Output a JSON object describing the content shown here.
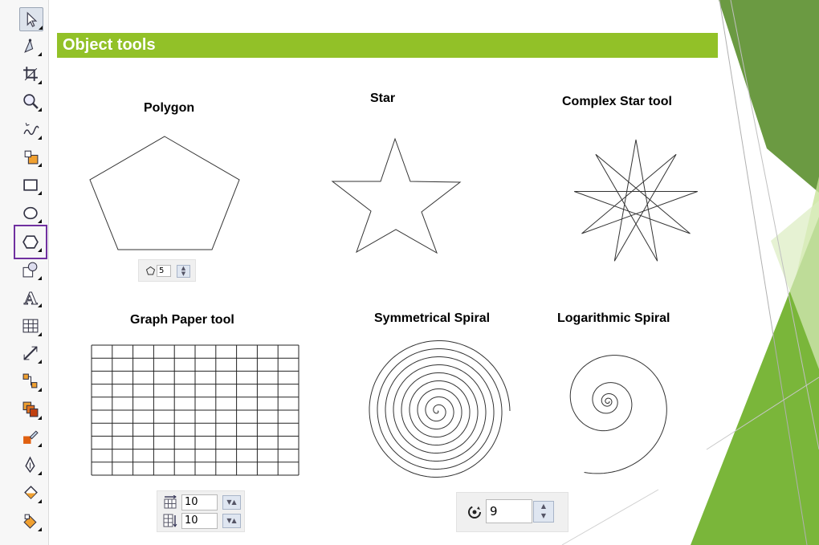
{
  "section": {
    "title": "Object tools"
  },
  "colors": {
    "banner": "#92c128",
    "highlight_frame": "#7030a0",
    "deco_greens": [
      "#6b9a42",
      "#7ab63a",
      "#c8e39a"
    ]
  },
  "toolbar": {
    "tools": [
      {
        "icon": "pick-arrow-icon"
      },
      {
        "icon": "shape-edit-icon"
      },
      {
        "icon": "crop-icon"
      },
      {
        "icon": "zoom-icon"
      },
      {
        "icon": "freehand-icon"
      },
      {
        "icon": "smart-fill-icon"
      },
      {
        "icon": "rectangle-icon"
      },
      {
        "icon": "ellipse-icon"
      },
      {
        "icon": "polygon-icon",
        "selected": true
      },
      {
        "icon": "basic-shapes-icon"
      },
      {
        "icon": "text-icon"
      },
      {
        "icon": "table-icon"
      },
      {
        "icon": "dimension-icon"
      },
      {
        "icon": "connector-icon"
      },
      {
        "icon": "blend-icon"
      },
      {
        "icon": "eyedropper-icon"
      },
      {
        "icon": "outline-pen-icon"
      },
      {
        "icon": "fill-icon"
      },
      {
        "icon": "interactive-fill-icon"
      }
    ]
  },
  "polygon": {
    "label": "Polygon",
    "sides": "5"
  },
  "star": {
    "label": "Star"
  },
  "complex_star": {
    "label": "Complex Star tool",
    "points": 9
  },
  "graph_paper": {
    "label": "Graph Paper tool",
    "columns": "10",
    "rows": "10"
  },
  "symmetrical_spiral": {
    "label": "Symmetrical Spiral",
    "revolutions": "9"
  },
  "logarithmic_spiral": {
    "label": "Logarithmic Spiral"
  }
}
